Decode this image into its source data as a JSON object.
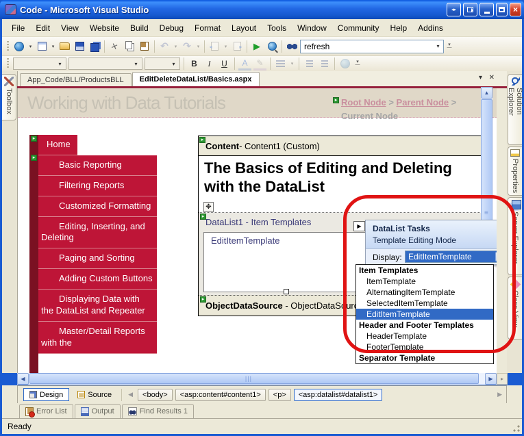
{
  "colors": {
    "titlebar_blue": "#1C5AD4",
    "toolbar_beige": "#ECE9D8",
    "nav_red": "#BE1537",
    "nav_dark_red": "#7A1122",
    "selection_blue": "#316AC5",
    "annotation_red": "#E01313",
    "breadcrumb_link_pink": "#C98F9E",
    "maroon_rule": "#96203C"
  },
  "titlebar": {
    "title": "Code - Microsoft Visual Studio"
  },
  "menubar": {
    "items": [
      "File",
      "Edit",
      "View",
      "Website",
      "Build",
      "Debug",
      "Format",
      "Layout",
      "Tools",
      "Window",
      "Community",
      "Help",
      "Addins"
    ]
  },
  "toolbar": {
    "search_value": "refresh"
  },
  "doc_tabs": {
    "inactive": "App_Code/BLL/ProductsBLL",
    "active": "EditDeleteDataList/Basics.aspx"
  },
  "side_tabs": {
    "left": "Toolbox",
    "right": [
      "Solution Explorer",
      "Properties",
      "Server Explorer",
      "Class View"
    ]
  },
  "design": {
    "page_title": "Working with Data Tutorials",
    "breadcrumb": {
      "root": "Root Node",
      "sep1": " > ",
      "parent": "Parent Node",
      "sep2": " > ",
      "current": "Current Node"
    },
    "nav": [
      "Home",
      "Basic Reporting",
      "Filtering Reports",
      "Customized Formatting",
      "Editing, Inserting, and Deleting",
      "Paging and Sorting",
      "Adding Custom Buttons",
      "Displaying Data with the DataList and Repeater",
      "Master/Detail Reports with the"
    ],
    "content_header": {
      "bold": "Content",
      "rest": " - Content1 (Custom)"
    },
    "heading": "The Basics of Editing and Deleting with the DataList",
    "datalist_label": "DataList1 - Item Templates",
    "template_label": "EditItemTemplate",
    "ods": {
      "bold": "ObjectDataSource",
      "rest": " - ObjectDataSource1"
    }
  },
  "tasks_popup": {
    "title": "DataList Tasks",
    "subtitle": "Template Editing Mode",
    "display_label": "Display:",
    "display_value": "EditItemTemplate",
    "list": [
      {
        "label": "Item Templates",
        "style": "header"
      },
      {
        "label": "ItemTemplate",
        "style": "item"
      },
      {
        "label": "AlternatingItemTemplate",
        "style": "item"
      },
      {
        "label": "SelectedItemTemplate",
        "style": "item"
      },
      {
        "label": "EditItemTemplate",
        "style": "item",
        "selected": true
      },
      {
        "label": "Header and Footer Templates",
        "style": "header"
      },
      {
        "label": "HeaderTemplate",
        "style": "item"
      },
      {
        "label": "FooterTemplate",
        "style": "item"
      },
      {
        "label": "Separator Template",
        "style": "header"
      }
    ]
  },
  "bottom": {
    "view_tabs": {
      "design": "Design",
      "source": "Source"
    },
    "tag_path": [
      "<body>",
      "<asp:content#content1>",
      "<p>",
      "<asp:datalist#datalist1>"
    ],
    "panel_tabs": [
      "Error List",
      "Output",
      "Find Results 1"
    ],
    "status": "Ready"
  }
}
